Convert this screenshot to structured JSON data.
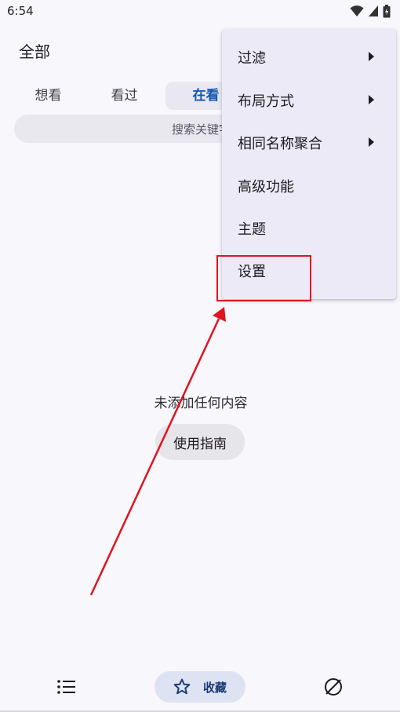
{
  "status_bar": {
    "time": "6:54"
  },
  "header": {
    "title": "全部"
  },
  "tabs": [
    {
      "label": "想看"
    },
    {
      "label": "看过"
    },
    {
      "label": "在看"
    }
  ],
  "search": {
    "placeholder": "搜索关键字"
  },
  "empty_state": {
    "message": "未添加任何内容",
    "guide_button": "使用指南"
  },
  "bottom_nav": {
    "items": [
      {
        "icon": "list-icon",
        "label": ""
      },
      {
        "icon": "star-icon",
        "label": "收藏",
        "active": true
      },
      {
        "icon": "explore-icon",
        "label": ""
      }
    ]
  },
  "menu": {
    "items": [
      {
        "label": "过滤",
        "has_submenu": true
      },
      {
        "label": "布局方式",
        "has_submenu": true
      },
      {
        "label": "相同名称聚合",
        "has_submenu": true
      },
      {
        "label": "高级功能",
        "has_submenu": false
      },
      {
        "label": "主题",
        "has_submenu": false
      },
      {
        "label": "设置",
        "has_submenu": false
      }
    ]
  },
  "colors": {
    "background": "#f8f7fc",
    "accent": "#1558b0",
    "menu_background": "#eceaf6",
    "annotation": "#e0141f"
  }
}
